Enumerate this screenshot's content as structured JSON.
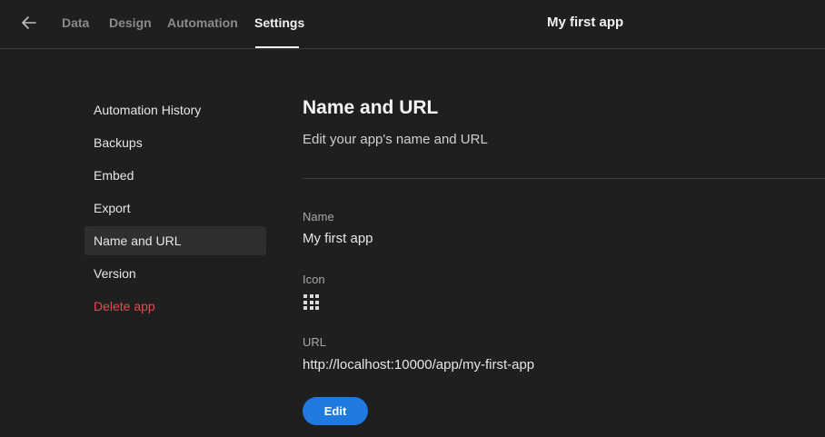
{
  "header": {
    "back_icon": "arrow-left-icon",
    "tabs": [
      {
        "label": "Data",
        "active": false
      },
      {
        "label": "Design",
        "active": false
      },
      {
        "label": "Automation",
        "active": false
      },
      {
        "label": "Settings",
        "active": true
      }
    ],
    "app_title": "My first app"
  },
  "sidebar": {
    "items": [
      {
        "label": "Automation History",
        "selected": false
      },
      {
        "label": "Backups",
        "selected": false
      },
      {
        "label": "Embed",
        "selected": false
      },
      {
        "label": "Export",
        "selected": false
      },
      {
        "label": "Name and URL",
        "selected": true
      },
      {
        "label": "Version",
        "selected": false
      },
      {
        "label": "Delete app",
        "selected": false,
        "danger": true
      }
    ]
  },
  "main": {
    "title": "Name and URL",
    "subtitle": "Edit your app's name and URL",
    "name_label": "Name",
    "name_value": "My first app",
    "icon_label": "Icon",
    "icon_name": "grid-icon",
    "url_label": "URL",
    "url_value": "http://localhost:10000/app/my-first-app",
    "edit_label": "Edit"
  },
  "colors": {
    "background": "#1f1f1f",
    "accent": "#1f7ae0",
    "danger": "#e5484d",
    "selected_item": "#2f2f2f"
  }
}
